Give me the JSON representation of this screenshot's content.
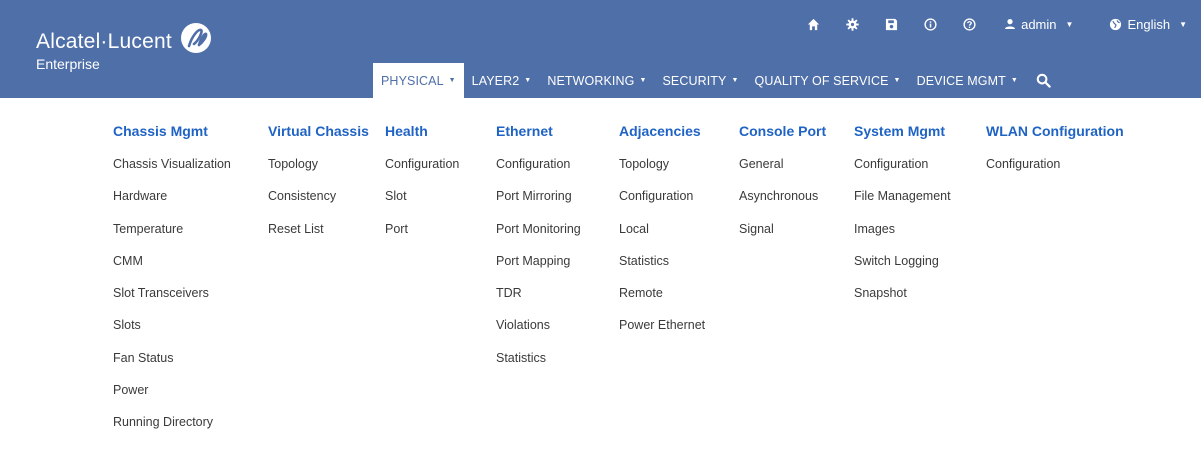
{
  "brand": {
    "name": "Alcatel·Lucent",
    "sub": "Enterprise",
    "bg_color": "#4f6fa8",
    "link_title_color": "#1f63c4"
  },
  "utility": {
    "icons": [
      "home-icon",
      "settings-icon",
      "save-icon",
      "info-icon",
      "help-icon"
    ],
    "user": {
      "icon": "user-icon",
      "label": "admin"
    },
    "language": {
      "icon": "globe-icon",
      "label": "English"
    }
  },
  "nav": {
    "items": [
      {
        "label": "PHYSICAL",
        "active": true
      },
      {
        "label": "LAYER2",
        "active": false
      },
      {
        "label": "NETWORKING",
        "active": false
      },
      {
        "label": "SECURITY",
        "active": false
      },
      {
        "label": "QUALITY OF SERVICE",
        "active": false
      },
      {
        "label": "DEVICE MGMT",
        "active": false
      }
    ],
    "search_icon": "search-icon"
  },
  "menu": {
    "columns": [
      {
        "title": "Chassis Mgmt",
        "links": [
          "Chassis Visualization",
          "Hardware",
          "Temperature",
          "CMM",
          "Slot Transceivers",
          "Slots",
          "Fan Status",
          "Power",
          "Running Directory"
        ]
      },
      {
        "title": "Virtual Chassis",
        "links": [
          "Topology",
          "Consistency",
          "Reset List"
        ]
      },
      {
        "title": "Health",
        "links": [
          "Configuration",
          "Slot",
          "Port"
        ]
      },
      {
        "title": "Ethernet",
        "links": [
          "Configuration",
          "Port Mirroring",
          "Port Monitoring",
          "Port Mapping",
          "TDR",
          "Violations",
          "Statistics"
        ]
      },
      {
        "title": "Adjacencies",
        "links": [
          "Topology",
          "Configuration",
          "Local",
          "Statistics",
          "Remote",
          "Power Ethernet"
        ]
      },
      {
        "title": "Console Port",
        "links": [
          "General",
          "Asynchronous",
          "Signal"
        ]
      },
      {
        "title": "System Mgmt",
        "links": [
          "Configuration",
          "File Management",
          "Images",
          "Switch Logging",
          "Snapshot"
        ]
      },
      {
        "title": "WLAN Configuration",
        "links": [
          "Configuration"
        ]
      }
    ]
  }
}
